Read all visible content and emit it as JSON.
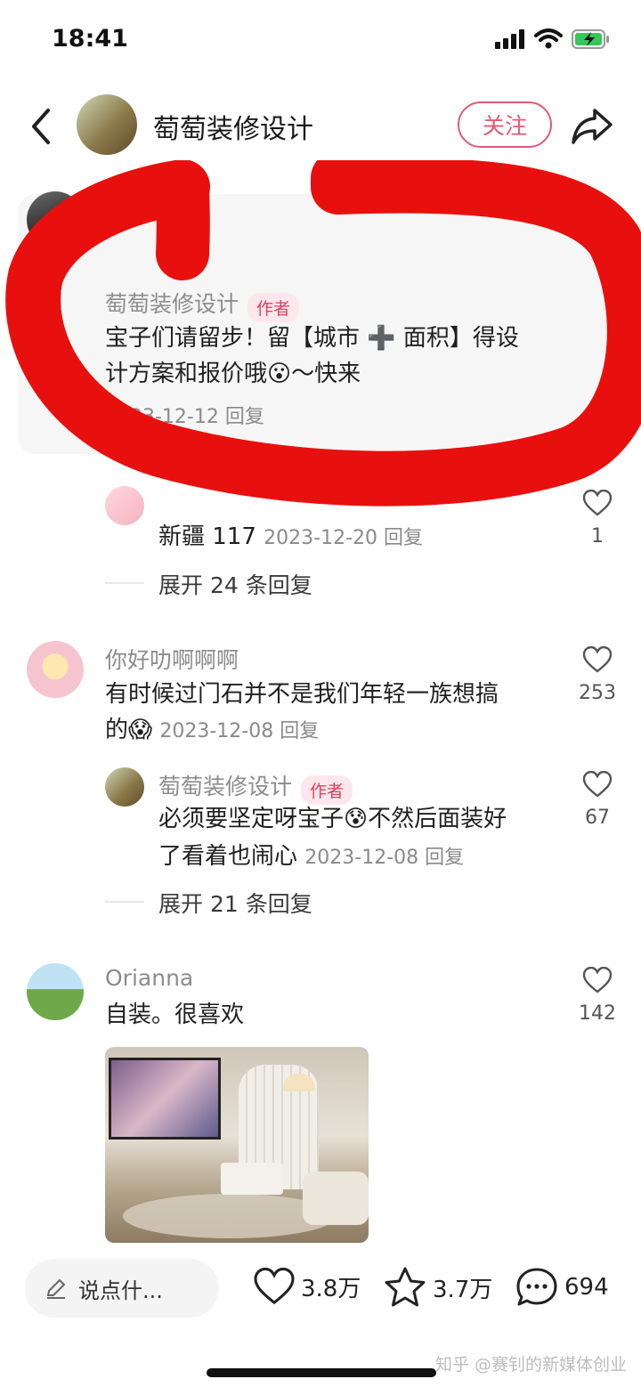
{
  "status_bar": {
    "time": "18:41"
  },
  "header": {
    "title": "萄萄装修设计",
    "follow_label": "关注"
  },
  "pinned": {
    "author": "萄萄装修设计",
    "tag": "作者",
    "line1": "宝子们请留步！留【城市 ➕ 面积】得设",
    "line2": "计方案和报价哦😮～快来",
    "meta": "2023-12-12 回复"
  },
  "reply1": {
    "location": "新疆 117",
    "meta": "2023-12-20 回复",
    "likes": "1",
    "expand": "展开 24 条回复"
  },
  "comment2": {
    "author": "你好叻啊啊啊",
    "line1": "有时候过门石并不是我们年轻一族想搞",
    "line2_prefix": "的😱",
    "meta": "2023-12-08 回复",
    "likes": "253",
    "reply": {
      "author": "萄萄装修设计",
      "tag": "作者",
      "line1": "必须要坚定呀宝子😰不然后面装好",
      "line2": "了看着也闹心",
      "meta": "2023-12-08 回复",
      "likes": "67"
    },
    "expand": "展开 21 条回复"
  },
  "comment3": {
    "author": "Orianna",
    "text": "自装。很喜欢",
    "likes": "142"
  },
  "bottom_bar": {
    "input_placeholder": "说点什...",
    "likes": "3.8万",
    "favorites": "3.7万",
    "comments": "694"
  },
  "watermark": "知乎 @赛钊的新媒体创业",
  "colors": {
    "accent": "#e15a73",
    "scribble": "#e8100e"
  }
}
